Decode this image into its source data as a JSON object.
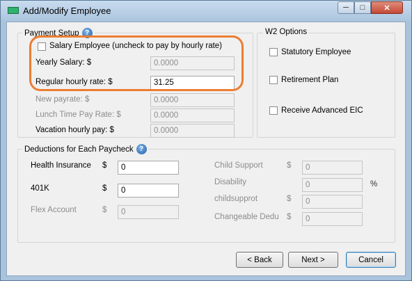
{
  "window": {
    "title": "Add/Modify Employee",
    "controls": {
      "minimize": "─",
      "maximize": "□",
      "close": "✕"
    }
  },
  "payment_setup": {
    "title": "Payment Setup",
    "help_glyph": "?",
    "salary_checkbox_label": "Salary Employee (uncheck to pay by hourly rate)",
    "salary_checked": false,
    "yearly_salary": {
      "label": "Yearly Salary: $",
      "value": "0.0000"
    },
    "regular_hourly_rate": {
      "label": "Regular hourly rate: $",
      "value": "31.25"
    },
    "new_payrate": {
      "label": "New payrate: $",
      "value": "0.0000"
    },
    "lunch_time_pay_rate": {
      "label": "Lunch Time Pay Rate: $",
      "value": "0.0000"
    },
    "vacation_hourly_pay": {
      "label": "Vacation hourly pay: $",
      "value": "0.0000"
    }
  },
  "w2_options": {
    "title": "W2 Options",
    "items": [
      {
        "label": "Statutory Employee",
        "checked": false
      },
      {
        "label": "Retirement Plan",
        "checked": false
      },
      {
        "label": "Receive Advanced EIC",
        "checked": false
      }
    ]
  },
  "deductions": {
    "title": "Deductions for Each Paycheck",
    "help_glyph": "?",
    "left": [
      {
        "label": "Health Insurance",
        "currency": "$",
        "value": "0",
        "enabled": true
      },
      {
        "label": "401K",
        "currency": "$",
        "value": "0",
        "enabled": true
      },
      {
        "label": "Flex Account",
        "currency": "$",
        "value": "0",
        "enabled": false
      }
    ],
    "right": [
      {
        "label": "Child Support",
        "prefix": "$",
        "value": "0",
        "suffix": ""
      },
      {
        "label": "Disability",
        "prefix": "",
        "value": "0",
        "suffix": "%"
      },
      {
        "label": "childsupprot",
        "prefix": "$",
        "value": "0",
        "suffix": ""
      },
      {
        "label": "Changeable Dedu",
        "prefix": "$",
        "value": "0",
        "suffix": ""
      }
    ]
  },
  "buttons": {
    "back": "< Back",
    "next": "Next >",
    "cancel": "Cancel"
  },
  "colors": {
    "accent_highlight": "#ec7d31",
    "title_bar": "#aac4de",
    "close_button": "#c44a35"
  }
}
